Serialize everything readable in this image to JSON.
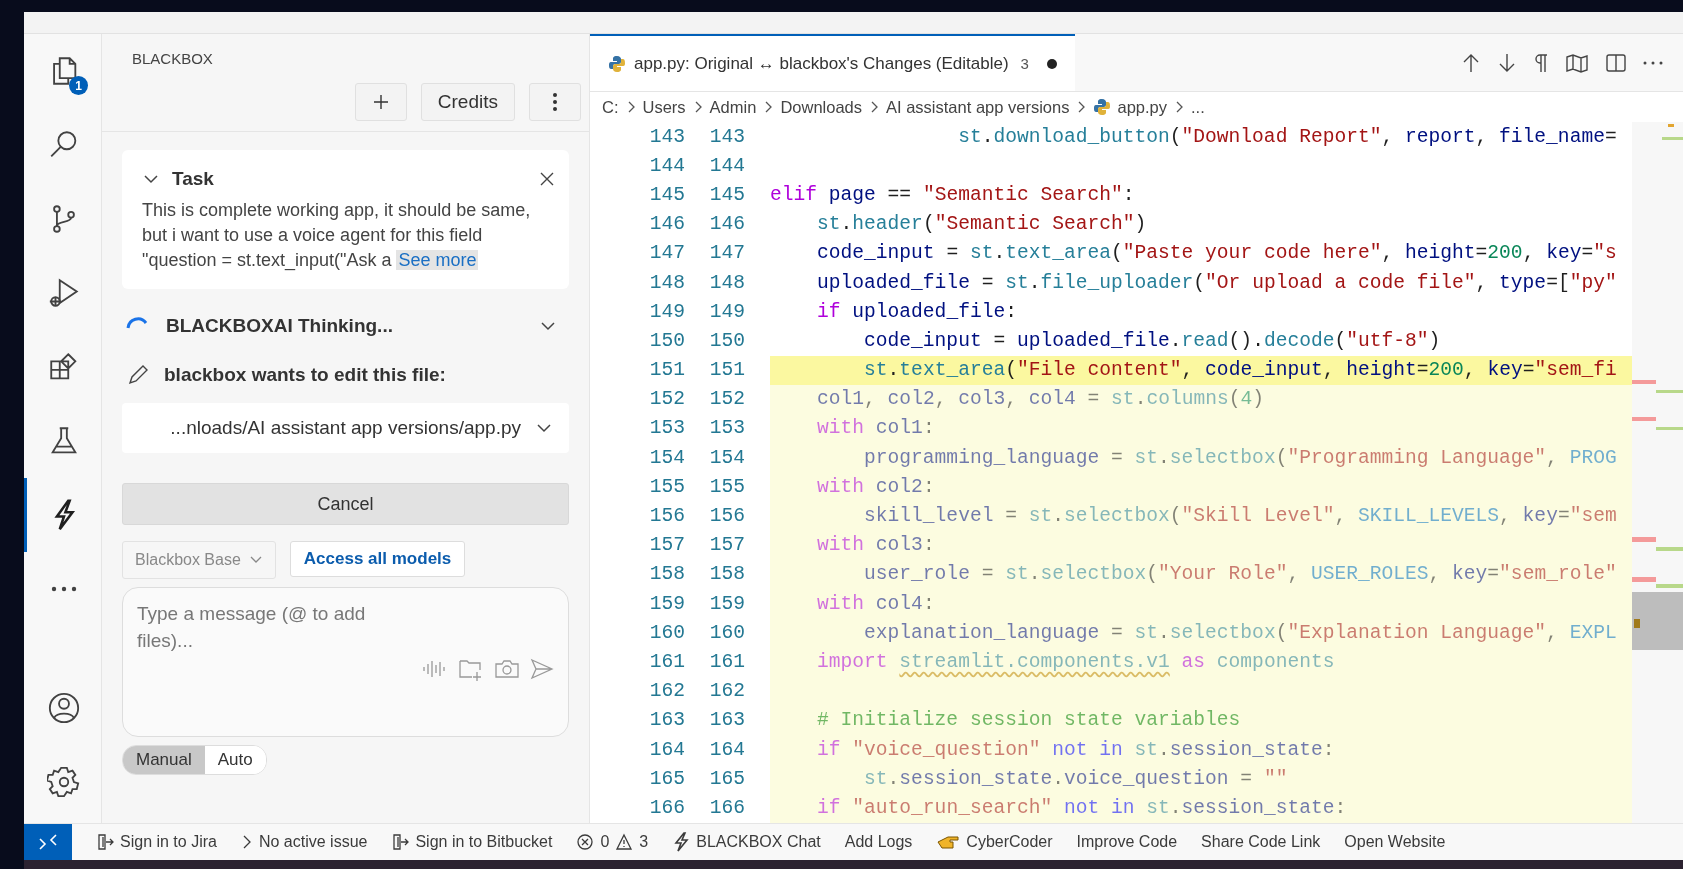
{
  "activity_bar": [
    {
      "badge": "1",
      "selected": false
    },
    {
      "selected": false
    },
    {
      "selected": false
    },
    {
      "selected": false
    },
    {
      "selected": false
    },
    {
      "selected": false
    },
    {
      "selected": true
    },
    {
      "selected": false
    },
    {
      "selected": false
    },
    {
      "selected": false
    }
  ],
  "sidebar": {
    "title": "BLACKBOX",
    "credits_button": "Credits",
    "task": {
      "title": "Task",
      "expanded": true,
      "body": "This is complete working app, it should be same, but i want to use a voice agent for this field \"question = st.text_input(\"Ask a",
      "link": "See more"
    },
    "thinking": {
      "label": "BLACKBOXAI Thinking..."
    },
    "edit_notice": {
      "label": "blackbox wants to edit this file:",
      "file": "...nloads/AI assistant app versions/app.py"
    },
    "cancel_button": "Cancel",
    "model": {
      "value": "Blackbox Base",
      "access_button": "Access all models"
    },
    "message": {
      "placeholder": "Type a message (@ to add files)..."
    },
    "modes": [
      {
        "label": "Manual",
        "selected": true
      },
      {
        "label": "Auto",
        "selected": false
      }
    ]
  },
  "editor": {
    "tab": {
      "label": "app.py: Original ↔ blackbox's Changes (Editable)",
      "count": "3",
      "dirty": true
    },
    "breadcrumb": [
      {
        "label": "C:",
        "kind": "folder"
      },
      {
        "label": "Users",
        "kind": "folder"
      },
      {
        "label": "Admin",
        "kind": "folder"
      },
      {
        "label": "Downloads",
        "kind": "folder"
      },
      {
        "label": "AI assistant app versions",
        "kind": "folder"
      },
      {
        "label": "app.py",
        "kind": "file"
      },
      {
        "label": "...",
        "kind": "more"
      }
    ],
    "lines": [
      {
        "old": "143",
        "new": "143",
        "current": false,
        "changed": false,
        "tokens": [
          {
            "t": "                st",
            "kind": "mod"
          },
          {
            "t": ".",
            "kind": "plain"
          },
          {
            "t": "download_button",
            "kind": "fn"
          },
          {
            "t": "(",
            "kind": "plain"
          },
          {
            "t": "\"Download Report\"",
            "kind": "str"
          },
          {
            "t": ", ",
            "kind": "plain"
          },
          {
            "t": "report",
            "kind": "var"
          },
          {
            "t": ", ",
            "kind": "plain"
          },
          {
            "t": "file_name",
            "kind": "var"
          },
          {
            "t": "=",
            "kind": "plain"
          }
        ]
      },
      {
        "old": "144",
        "new": "144",
        "current": false,
        "changed": false
      },
      {
        "old": "145",
        "new": "145",
        "current": false,
        "changed": false,
        "tokens": [
          {
            "t": "elif ",
            "kind": "kw"
          },
          {
            "t": "page",
            "kind": "var"
          },
          {
            "t": " == ",
            "kind": "plain"
          },
          {
            "t": "\"Semantic Search\"",
            "kind": "str"
          },
          {
            "t": ":",
            "kind": "plain"
          }
        ]
      },
      {
        "old": "146",
        "new": "146",
        "current": false,
        "changed": false,
        "tokens": [
          {
            "t": "    st",
            "kind": "mod"
          },
          {
            "t": ".",
            "kind": "plain"
          },
          {
            "t": "header",
            "kind": "fn"
          },
          {
            "t": "(",
            "kind": "plain"
          },
          {
            "t": "\"Semantic Search\"",
            "kind": "str"
          },
          {
            "t": ")",
            "kind": "plain"
          }
        ]
      },
      {
        "old": "147",
        "new": "147",
        "current": false,
        "changed": false,
        "tokens": [
          {
            "t": "    code_input",
            "kind": "var"
          },
          {
            "t": " = ",
            "kind": "plain"
          },
          {
            "t": "st",
            "kind": "mod"
          },
          {
            "t": ".",
            "kind": "plain"
          },
          {
            "t": "text_area",
            "kind": "fn"
          },
          {
            "t": "(",
            "kind": "plain"
          },
          {
            "t": "\"Paste your code here\"",
            "kind": "str"
          },
          {
            "t": ", ",
            "kind": "plain"
          },
          {
            "t": "height",
            "kind": "var"
          },
          {
            "t": "=",
            "kind": "plain"
          },
          {
            "t": "200",
            "kind": "num"
          },
          {
            "t": ", ",
            "kind": "plain"
          },
          {
            "t": "key",
            "kind": "var"
          },
          {
            "t": "=",
            "kind": "plain"
          },
          {
            "t": "\"s",
            "kind": "str"
          }
        ]
      },
      {
        "old": "148",
        "new": "148",
        "current": false,
        "changed": false,
        "tokens": [
          {
            "t": "    uploaded_file",
            "kind": "var"
          },
          {
            "t": " = ",
            "kind": "plain"
          },
          {
            "t": "st",
            "kind": "mod"
          },
          {
            "t": ".",
            "kind": "plain"
          },
          {
            "t": "file_uploader",
            "kind": "fn"
          },
          {
            "t": "(",
            "kind": "plain"
          },
          {
            "t": "\"Or upload a code file\"",
            "kind": "str"
          },
          {
            "t": ", ",
            "kind": "plain"
          },
          {
            "t": "type",
            "kind": "var"
          },
          {
            "t": "=[",
            "kind": "plain"
          },
          {
            "t": "\"py\"",
            "kind": "str"
          }
        ]
      },
      {
        "old": "149",
        "new": "149",
        "current": false,
        "changed": false,
        "tokens": [
          {
            "t": "    if ",
            "kind": "kw"
          },
          {
            "t": "uploaded_file",
            "kind": "var"
          },
          {
            "t": ":",
            "kind": "plain"
          }
        ]
      },
      {
        "old": "150",
        "new": "150",
        "current": false,
        "changed": false,
        "tokens": [
          {
            "t": "        code_input",
            "kind": "var"
          },
          {
            "t": " = ",
            "kind": "plain"
          },
          {
            "t": "uploaded_file",
            "kind": "var"
          },
          {
            "t": ".",
            "kind": "plain"
          },
          {
            "t": "read",
            "kind": "fn"
          },
          {
            "t": "().",
            "kind": "plain"
          },
          {
            "t": "decode",
            "kind": "fn"
          },
          {
            "t": "(",
            "kind": "plain"
          },
          {
            "t": "\"utf-8\"",
            "kind": "str"
          },
          {
            "t": ")",
            "kind": "plain"
          }
        ]
      },
      {
        "old": "151",
        "new": "151",
        "current": true,
        "changed": false,
        "tokens": [
          {
            "t": "        st",
            "kind": "mod"
          },
          {
            "t": ".",
            "kind": "plain"
          },
          {
            "t": "text_area",
            "kind": "fn"
          },
          {
            "t": "(",
            "kind": "plain"
          },
          {
            "t": "\"File content\"",
            "kind": "str"
          },
          {
            "t": ", ",
            "kind": "plain"
          },
          {
            "t": "code_input",
            "kind": "var"
          },
          {
            "t": ", ",
            "kind": "plain"
          },
          {
            "t": "height",
            "kind": "var"
          },
          {
            "t": "=",
            "kind": "plain"
          },
          {
            "t": "200",
            "kind": "num"
          },
          {
            "t": ", ",
            "kind": "plain"
          },
          {
            "t": "key",
            "kind": "var"
          },
          {
            "t": "=",
            "kind": "plain"
          },
          {
            "t": "\"sem_fi",
            "kind": "str"
          }
        ]
      },
      {
        "old": "152",
        "new": "152",
        "current": false,
        "changed": true,
        "tokens": [
          {
            "t": "    col1",
            "kind": "var"
          },
          {
            "t": ", ",
            "kind": "plain"
          },
          {
            "t": "col2",
            "kind": "var"
          },
          {
            "t": ", ",
            "kind": "plain"
          },
          {
            "t": "col3",
            "kind": "var"
          },
          {
            "t": ", ",
            "kind": "plain"
          },
          {
            "t": "col4",
            "kind": "var"
          },
          {
            "t": " = ",
            "kind": "plain"
          },
          {
            "t": "st",
            "kind": "mod"
          },
          {
            "t": ".",
            "kind": "plain"
          },
          {
            "t": "columns",
            "kind": "fn"
          },
          {
            "t": "(",
            "kind": "plain"
          },
          {
            "t": "4",
            "kind": "num"
          },
          {
            "t": ")",
            "kind": "plain"
          }
        ]
      },
      {
        "old": "153",
        "new": "153",
        "current": false,
        "changed": true,
        "tokens": [
          {
            "t": "    with ",
            "kind": "kw"
          },
          {
            "t": "col1",
            "kind": "var"
          },
          {
            "t": ":",
            "kind": "plain"
          }
        ]
      },
      {
        "old": "154",
        "new": "154",
        "current": false,
        "changed": true,
        "tokens": [
          {
            "t": "        programming_language",
            "kind": "var"
          },
          {
            "t": " = ",
            "kind": "plain"
          },
          {
            "t": "st",
            "kind": "mod"
          },
          {
            "t": ".",
            "kind": "plain"
          },
          {
            "t": "selectbox",
            "kind": "fn"
          },
          {
            "t": "(",
            "kind": "plain"
          },
          {
            "t": "\"Programming Language\"",
            "kind": "str"
          },
          {
            "t": ", ",
            "kind": "plain"
          },
          {
            "t": "PROG",
            "kind": "const"
          }
        ]
      },
      {
        "old": "155",
        "new": "155",
        "current": false,
        "changed": true,
        "tokens": [
          {
            "t": "    with ",
            "kind": "kw"
          },
          {
            "t": "col2",
            "kind": "var"
          },
          {
            "t": ":",
            "kind": "plain"
          }
        ]
      },
      {
        "old": "156",
        "new": "156",
        "current": false,
        "changed": true,
        "tokens": [
          {
            "t": "        skill_level",
            "kind": "var"
          },
          {
            "t": " = ",
            "kind": "plain"
          },
          {
            "t": "st",
            "kind": "mod"
          },
          {
            "t": ".",
            "kind": "plain"
          },
          {
            "t": "selectbox",
            "kind": "fn"
          },
          {
            "t": "(",
            "kind": "plain"
          },
          {
            "t": "\"Skill Level\"",
            "kind": "str"
          },
          {
            "t": ", ",
            "kind": "plain"
          },
          {
            "t": "SKILL_LEVELS",
            "kind": "const"
          },
          {
            "t": ", ",
            "kind": "plain"
          },
          {
            "t": "key",
            "kind": "var"
          },
          {
            "t": "=",
            "kind": "plain"
          },
          {
            "t": "\"sem",
            "kind": "str"
          }
        ]
      },
      {
        "old": "157",
        "new": "157",
        "current": false,
        "changed": true,
        "tokens": [
          {
            "t": "    with ",
            "kind": "kw"
          },
          {
            "t": "col3",
            "kind": "var"
          },
          {
            "t": ":",
            "kind": "plain"
          }
        ]
      },
      {
        "old": "158",
        "new": "158",
        "current": false,
        "changed": true,
        "tokens": [
          {
            "t": "        user_role",
            "kind": "var"
          },
          {
            "t": " = ",
            "kind": "plain"
          },
          {
            "t": "st",
            "kind": "mod"
          },
          {
            "t": ".",
            "kind": "plain"
          },
          {
            "t": "selectbox",
            "kind": "fn"
          },
          {
            "t": "(",
            "kind": "plain"
          },
          {
            "t": "\"Your Role\"",
            "kind": "str"
          },
          {
            "t": ", ",
            "kind": "plain"
          },
          {
            "t": "USER_ROLES",
            "kind": "const"
          },
          {
            "t": ", ",
            "kind": "plain"
          },
          {
            "t": "key",
            "kind": "var"
          },
          {
            "t": "=",
            "kind": "plain"
          },
          {
            "t": "\"sem_role\"",
            "kind": "str"
          }
        ]
      },
      {
        "old": "159",
        "new": "159",
        "current": false,
        "changed": true,
        "tokens": [
          {
            "t": "    with ",
            "kind": "kw"
          },
          {
            "t": "col4",
            "kind": "var"
          },
          {
            "t": ":",
            "kind": "plain"
          }
        ]
      },
      {
        "old": "160",
        "new": "160",
        "current": false,
        "changed": true,
        "tokens": [
          {
            "t": "        explanation_language",
            "kind": "var"
          },
          {
            "t": " = ",
            "kind": "plain"
          },
          {
            "t": "st",
            "kind": "mod"
          },
          {
            "t": ".",
            "kind": "plain"
          },
          {
            "t": "selectbox",
            "kind": "fn"
          },
          {
            "t": "(",
            "kind": "plain"
          },
          {
            "t": "\"Explanation Language\"",
            "kind": "str"
          },
          {
            "t": ", ",
            "kind": "plain"
          },
          {
            "t": "EXPL",
            "kind": "const"
          }
        ]
      },
      {
        "old": "161",
        "new": "161",
        "current": false,
        "changed": true,
        "tokens": [
          {
            "t": "    import ",
            "kind": "kw"
          },
          {
            "t": "streamlit.components.v1",
            "kind": "unresolved"
          },
          {
            "t": " as ",
            "kind": "kw"
          },
          {
            "t": "components",
            "kind": "mod"
          }
        ]
      },
      {
        "old": "162",
        "new": "162",
        "current": false,
        "changed": true
      },
      {
        "old": "163",
        "new": "163",
        "current": false,
        "changed": true,
        "tokens": [
          {
            "t": "    # Initialize session state variables",
            "kind": "com"
          }
        ]
      },
      {
        "old": "164",
        "new": "164",
        "current": false,
        "changed": true,
        "tokens": [
          {
            "t": "    if ",
            "kind": "kw"
          },
          {
            "t": "\"voice_question\"",
            "kind": "str"
          },
          {
            "t": " not in ",
            "kind": "kw2"
          },
          {
            "t": "st",
            "kind": "mod"
          },
          {
            "t": ".",
            "kind": "plain"
          },
          {
            "t": "session_state",
            "kind": "var"
          },
          {
            "t": ":",
            "kind": "plain"
          }
        ]
      },
      {
        "old": "165",
        "new": "165",
        "current": false,
        "changed": true,
        "tokens": [
          {
            "t": "        st",
            "kind": "mod"
          },
          {
            "t": ".",
            "kind": "plain"
          },
          {
            "t": "session_state",
            "kind": "var"
          },
          {
            "t": ".",
            "kind": "plain"
          },
          {
            "t": "voice_question",
            "kind": "var"
          },
          {
            "t": " = ",
            "kind": "plain"
          },
          {
            "t": "\"\"",
            "kind": "str"
          }
        ]
      },
      {
        "old": "166",
        "new": "166",
        "current": false,
        "changed": true,
        "tokens": [
          {
            "t": "    if ",
            "kind": "kw"
          },
          {
            "t": "\"auto_run_search\"",
            "kind": "str"
          },
          {
            "t": " not in ",
            "kind": "kw2"
          },
          {
            "t": "st",
            "kind": "mod"
          },
          {
            "t": ".",
            "kind": "plain"
          },
          {
            "t": "session_state",
            "kind": "var"
          },
          {
            "t": ":",
            "kind": "plain"
          }
        ]
      }
    ]
  },
  "status_bar": [
    {
      "kind": "signin",
      "label": "Sign in to Jira"
    },
    {
      "kind": "chevron",
      "label": "No active issue"
    },
    {
      "kind": "signin",
      "label": "Sign in to Bitbucket"
    },
    {
      "kind": "problems",
      "errors": "0",
      "warnings": "3"
    },
    {
      "kind": "bolt",
      "label": "BLACKBOX Chat"
    },
    {
      "kind": "text",
      "label": "Add Logs"
    },
    {
      "kind": "hand",
      "label": "CyberCoder"
    },
    {
      "kind": "text",
      "label": "Improve Code"
    },
    {
      "kind": "text",
      "label": "Share Code Link"
    },
    {
      "kind": "text",
      "label": "Open Website"
    }
  ]
}
